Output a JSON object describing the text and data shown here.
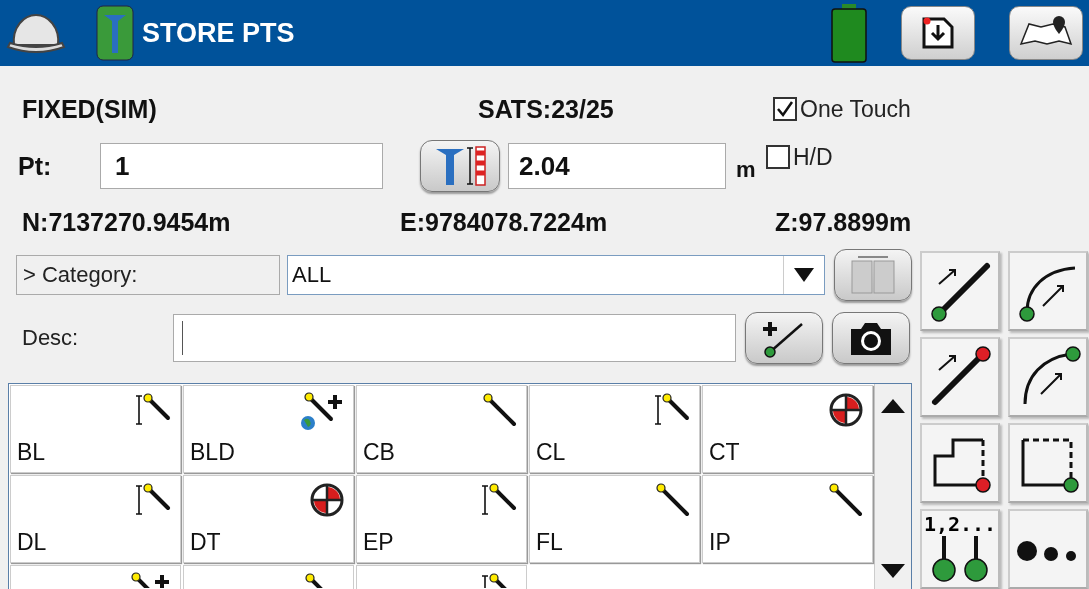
{
  "header": {
    "title": "STORE PTS"
  },
  "status": {
    "solution": "FIXED(SIM)",
    "sats": "SATS:23/25"
  },
  "options": [
    {
      "label": "One Touch",
      "checked": true
    },
    {
      "label": "H/D",
      "checked": false
    }
  ],
  "point": {
    "label": "Pt:",
    "value": "1"
  },
  "height": {
    "value": "2.04",
    "unit": "m"
  },
  "coords": [
    "N:7137270.9454m",
    "E:9784078.7224m",
    "Z:97.8899m"
  ],
  "category": {
    "label": "> Category:",
    "value": "ALL"
  },
  "desc": {
    "label": "Desc:"
  },
  "codes": [
    {
      "label": "BL",
      "kind": "z-pole"
    },
    {
      "label": "BLD",
      "kind": "pole-plus-globe"
    },
    {
      "label": "CB",
      "kind": "pole"
    },
    {
      "label": "CL",
      "kind": "z-pole"
    },
    {
      "label": "CT",
      "kind": "target"
    },
    {
      "label": "DL",
      "kind": "z-pole"
    },
    {
      "label": "DT",
      "kind": "target"
    },
    {
      "label": "EP",
      "kind": "z-pole"
    },
    {
      "label": "FL",
      "kind": "pole"
    },
    {
      "label": "IP",
      "kind": "pole"
    },
    {
      "kind": "pole-plus"
    },
    {
      "kind": "pole"
    },
    {
      "kind": "z-pole"
    }
  ],
  "tools": [
    {
      "kind": "line-start"
    },
    {
      "kind": "arc-start"
    },
    {
      "kind": "line-end"
    },
    {
      "kind": "arc-end"
    },
    {
      "kind": "polygon"
    },
    {
      "kind": "rectangle"
    },
    {
      "kind": "numbered",
      "label": "1,2..."
    },
    {
      "kind": "dots"
    }
  ]
}
